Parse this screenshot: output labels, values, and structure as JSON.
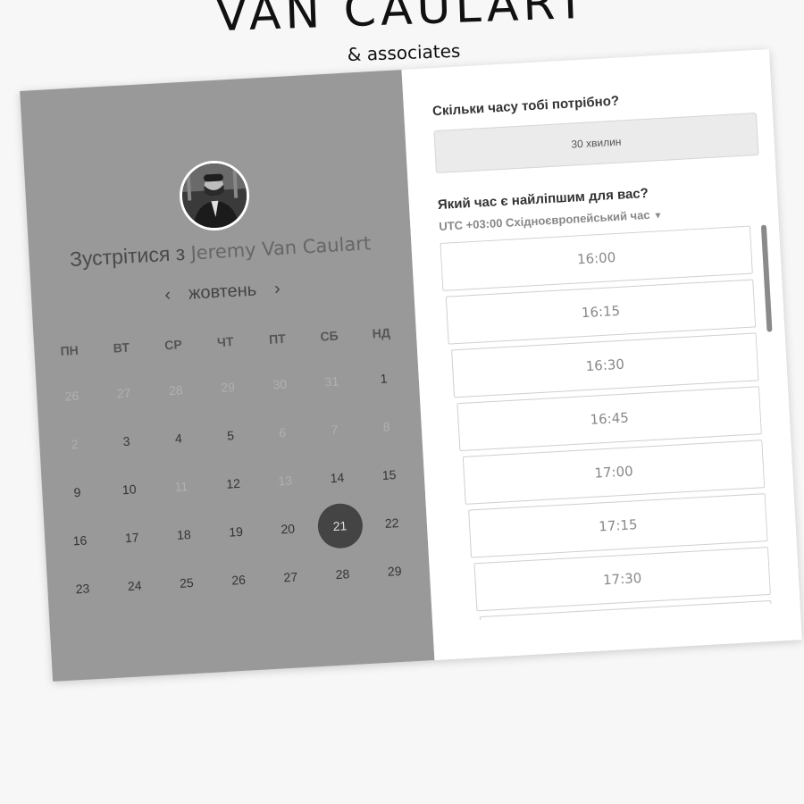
{
  "brand": {
    "name": "VAN CAULART",
    "subtitle": "& associates"
  },
  "calendar": {
    "meet_prefix": "Зустрітися з",
    "host_name": "Jeremy Van Caulart",
    "month": "жовтень",
    "prev_icon": "‹",
    "next_icon": "›",
    "weekdays": [
      "ПН",
      "ВТ",
      "СР",
      "ЧТ",
      "ПТ",
      "СБ",
      "НД"
    ],
    "weeks": [
      [
        {
          "d": "26",
          "s": "muted"
        },
        {
          "d": "27",
          "s": "muted"
        },
        {
          "d": "28",
          "s": "muted"
        },
        {
          "d": "29",
          "s": "muted"
        },
        {
          "d": "30",
          "s": "muted"
        },
        {
          "d": "31",
          "s": "muted"
        },
        {
          "d": "1",
          "s": ""
        }
      ],
      [
        {
          "d": "2",
          "s": "muted"
        },
        {
          "d": "3",
          "s": ""
        },
        {
          "d": "4",
          "s": ""
        },
        {
          "d": "5",
          "s": ""
        },
        {
          "d": "6",
          "s": "muted"
        },
        {
          "d": "7",
          "s": "muted"
        },
        {
          "d": "8",
          "s": "muted"
        }
      ],
      [
        {
          "d": "9",
          "s": ""
        },
        {
          "d": "10",
          "s": ""
        },
        {
          "d": "11",
          "s": "muted"
        },
        {
          "d": "12",
          "s": ""
        },
        {
          "d": "13",
          "s": "muted"
        },
        {
          "d": "14",
          "s": ""
        },
        {
          "d": "15",
          "s": ""
        }
      ],
      [
        {
          "d": "16",
          "s": ""
        },
        {
          "d": "17",
          "s": ""
        },
        {
          "d": "18",
          "s": ""
        },
        {
          "d": "19",
          "s": ""
        },
        {
          "d": "20",
          "s": ""
        },
        {
          "d": "21",
          "s": "selected"
        },
        {
          "d": "22",
          "s": ""
        }
      ],
      [
        {
          "d": "23",
          "s": ""
        },
        {
          "d": "24",
          "s": ""
        },
        {
          "d": "25",
          "s": ""
        },
        {
          "d": "26",
          "s": ""
        },
        {
          "d": "27",
          "s": ""
        },
        {
          "d": "28",
          "s": ""
        },
        {
          "d": "29",
          "s": ""
        }
      ]
    ]
  },
  "booking": {
    "duration_question": "Скільки часу тобі потрібно?",
    "duration_value": "30 хвилин",
    "time_question": "Який час є найліпшим для вас?",
    "timezone": "UTC +03:00 Східноєвропейський час",
    "slots": [
      "16:00",
      "16:15",
      "16:30",
      "16:45",
      "17:00",
      "17:15",
      "17:30",
      ""
    ]
  }
}
